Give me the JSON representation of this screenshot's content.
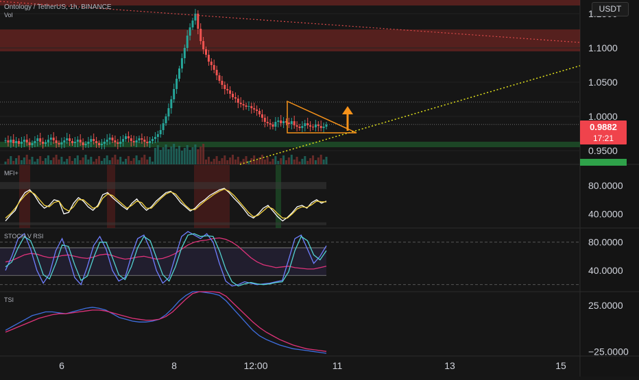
{
  "header": {
    "symbol_line": "Ontology / TetherUS, 1h, BINANCE",
    "vol_label": "Vol",
    "currency": "USDT"
  },
  "price_badge": {
    "price": "0.9882",
    "countdown": "17:21"
  },
  "panels": {
    "mfi": {
      "label": "MFI+",
      "ticks": [
        "80.0000",
        "40.0000"
      ]
    },
    "stoch": {
      "label": "STOCH V RSI",
      "ticks": [
        "80.0000",
        "40.0000"
      ]
    },
    "tsi": {
      "label": "TSI",
      "ticks": [
        "25.0000",
        "−25.0000"
      ]
    }
  },
  "chart_data": [
    {
      "type": "candlestick",
      "title": "Ontology / TetherUS, 1h, BINANCE",
      "y_ticks": [
        "1.1500",
        "1.1000",
        "1.0500",
        "1.0000",
        "0.9500"
      ],
      "y_tick_values": [
        1.15,
        1.1,
        1.05,
        1.0,
        0.95
      ],
      "ylim": [
        0.93,
        1.17
      ],
      "x_ticks": [
        "6",
        "8",
        "12:00",
        "11",
        "13",
        "15"
      ],
      "last_price": 0.9882,
      "resistance_zones": [
        [
          1.162,
          1.177
        ],
        [
          1.095,
          1.127
        ]
      ],
      "support_zone": [
        0.955,
        0.963
      ],
      "colors": {
        "up": "#26a69a",
        "down": "#ef5350",
        "pattern": "#f7931a",
        "support_line": "#e5e51c",
        "resistance_line": "#e04b4b"
      },
      "close_series": [
        0.965,
        0.962,
        0.966,
        0.961,
        0.964,
        0.96,
        0.963,
        0.966,
        0.962,
        0.958,
        0.961,
        0.964,
        0.968,
        0.963,
        0.96,
        0.962,
        0.966,
        0.969,
        0.965,
        0.961,
        0.959,
        0.962,
        0.965,
        0.968,
        0.964,
        0.961,
        0.963,
        0.966,
        0.962,
        0.958,
        0.96,
        0.963,
        0.967,
        0.964,
        0.961,
        0.958,
        0.96,
        0.963,
        0.966,
        0.969,
        0.965,
        0.962,
        0.96,
        0.963,
        0.967,
        0.971,
        0.968,
        0.964,
        0.962,
        0.965,
        0.968,
        0.966,
        0.963,
        0.961,
        0.964,
        0.967,
        0.97,
        0.974,
        0.98,
        0.99,
        1.0,
        1.012,
        1.025,
        1.04,
        1.055,
        1.07,
        1.085,
        1.1,
        1.118,
        1.13,
        1.14,
        1.15,
        1.128,
        1.11,
        1.098,
        1.09,
        1.08,
        1.075,
        1.068,
        1.06,
        1.052,
        1.046,
        1.04,
        1.038,
        1.033,
        1.028,
        1.026,
        1.02,
        1.018,
        1.016,
        1.014,
        1.015,
        1.012,
        1.01,
        1.008,
        1.003,
        0.998,
        0.992,
        0.99,
        0.988,
        0.985,
        0.992,
        0.994,
        0.99,
        0.993,
        0.991,
        0.989,
        0.993,
        0.987,
        0.985,
        0.983,
        0.986,
        0.99,
        0.987,
        0.985,
        0.984,
        0.988,
        0.986,
        0.983,
        0.985,
        0.988
      ]
    },
    {
      "type": "line",
      "title": "MFI+",
      "y_ticks": [
        "80.0000",
        "40.0000"
      ],
      "y_tick_values": [
        80,
        40
      ],
      "ylim": [
        20,
        110
      ],
      "series": [
        {
          "color": "#ffffff",
          "values": [
            30,
            38,
            45,
            60,
            70,
            74,
            66,
            55,
            48,
            52,
            60,
            58,
            40,
            42,
            55,
            63,
            58,
            50,
            45,
            52,
            67,
            70,
            63,
            57,
            51,
            46,
            55,
            61,
            52,
            45,
            50,
            58,
            64,
            70,
            72,
            65,
            56,
            50,
            44,
            48,
            55,
            60,
            66,
            70,
            74,
            76,
            70,
            62,
            55,
            47,
            38,
            34,
            40,
            48,
            52,
            44,
            36,
            30,
            35,
            42,
            50,
            52,
            48,
            56,
            60,
            55,
            58
          ]
        },
        {
          "color": "#f5d442",
          "values": [
            34,
            40,
            48,
            58,
            66,
            72,
            68,
            60,
            52,
            50,
            56,
            58,
            48,
            44,
            50,
            60,
            60,
            54,
            48,
            50,
            62,
            68,
            66,
            60,
            54,
            48,
            52,
            58,
            56,
            48,
            48,
            55,
            62,
            68,
            71,
            68,
            60,
            52,
            46,
            46,
            52,
            58,
            63,
            68,
            72,
            75,
            72,
            66,
            58,
            50,
            42,
            36,
            38,
            44,
            50,
            47,
            40,
            34,
            34,
            40,
            47,
            50,
            49,
            53,
            58,
            57,
            57
          ]
        }
      ]
    },
    {
      "type": "line",
      "title": "STOCH V RSI",
      "y_ticks": [
        "80.0000",
        "40.0000"
      ],
      "y_tick_values": [
        80,
        40
      ],
      "ylim": [
        10,
        100
      ],
      "series": [
        {
          "color": "#e0337a",
          "values": [
            52,
            54,
            58,
            62,
            64,
            63,
            60,
            58,
            59,
            61,
            62,
            60,
            58,
            57,
            59,
            62,
            63,
            61,
            58,
            56,
            57,
            59,
            60,
            58,
            56,
            57,
            60,
            64,
            70,
            76,
            80,
            82,
            83,
            85,
            86,
            84,
            80,
            74,
            66,
            58,
            52,
            48,
            46,
            44,
            45,
            46,
            44,
            43,
            42,
            42,
            44,
            46
          ]
        },
        {
          "color": "#6f7fff",
          "values": [
            40,
            60,
            85,
            92,
            70,
            40,
            22,
            35,
            68,
            85,
            60,
            30,
            20,
            45,
            75,
            88,
            70,
            40,
            25,
            30,
            60,
            85,
            90,
            70,
            40,
            22,
            30,
            60,
            88,
            95,
            90,
            85,
            92,
            80,
            50,
            25,
            18,
            20,
            24,
            22,
            20,
            21,
            22,
            24,
            26,
            55,
            85,
            90,
            70,
            50,
            60,
            75
          ]
        },
        {
          "color": "#53d3d1",
          "values": [
            45,
            52,
            72,
            88,
            82,
            60,
            34,
            28,
            50,
            76,
            74,
            48,
            26,
            32,
            58,
            80,
            80,
            58,
            34,
            27,
            45,
            72,
            88,
            82,
            58,
            34,
            25,
            45,
            72,
            90,
            92,
            88,
            89,
            88,
            68,
            42,
            24,
            18,
            21,
            23,
            21,
            20,
            21,
            23,
            24,
            38,
            68,
            88,
            82,
            62,
            55,
            68
          ]
        }
      ]
    },
    {
      "type": "line",
      "title": "TSI",
      "y_ticks": [
        "25.0000",
        "−25.0000"
      ],
      "y_tick_values": [
        25,
        -25
      ],
      "ylim": [
        -30,
        40
      ],
      "series": [
        {
          "color": "#3f6fe0",
          "values": [
            -2,
            2,
            6,
            10,
            14,
            16,
            18,
            18,
            17,
            16,
            18,
            20,
            22,
            23,
            22,
            20,
            16,
            12,
            10,
            8,
            7,
            7,
            8,
            10,
            15,
            22,
            30,
            36,
            40,
            40,
            39,
            38,
            36,
            30,
            22,
            14,
            6,
            -2,
            -8,
            -12,
            -15,
            -18,
            -20,
            -22,
            -23,
            -24,
            -25,
            -26,
            -27
          ]
        },
        {
          "color": "#e0337a",
          "values": [
            -4,
            -1,
            2,
            5,
            8,
            11,
            13,
            15,
            16,
            16,
            17,
            18,
            19,
            20,
            20,
            19,
            17,
            15,
            13,
            11,
            10,
            9,
            9,
            10,
            13,
            18,
            25,
            32,
            38,
            40,
            40,
            40,
            39,
            35,
            28,
            21,
            14,
            7,
            1,
            -4,
            -8,
            -12,
            -15,
            -18,
            -20,
            -22,
            -23,
            -24,
            -25
          ]
        }
      ]
    }
  ]
}
